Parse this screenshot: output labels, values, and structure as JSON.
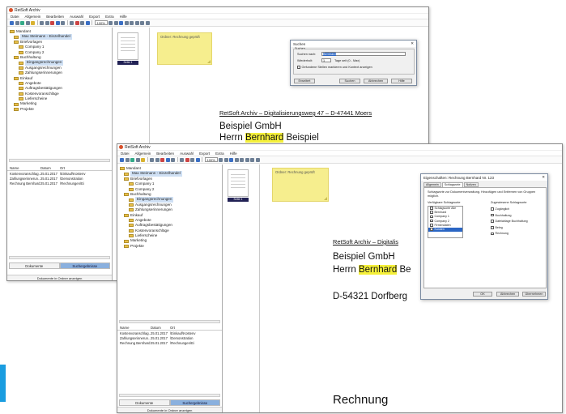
{
  "app": {
    "title": "RetSoft Archiv"
  },
  "menu": [
    "Datei",
    "Allgemein",
    "Bearbeiten",
    "Auswahl",
    "Export",
    "Extra",
    "Hilfe"
  ],
  "zoom": "100%",
  "tree": [
    {
      "label": "Mandant",
      "depth": 0
    },
    {
      "label": "Max Steimann - Einzelhandel",
      "depth": 1,
      "selected": true
    },
    {
      "label": "Briefvorlagen",
      "depth": 1
    },
    {
      "label": "Company 1",
      "depth": 2
    },
    {
      "label": "Company 2",
      "depth": 2
    },
    {
      "label": "Buchhaltung",
      "depth": 1
    },
    {
      "label": "Eingangsrechnungen",
      "depth": 2,
      "selected": true
    },
    {
      "label": "Ausgangsrechnungen",
      "depth": 2
    },
    {
      "label": "Zahlungserinnerungen",
      "depth": 2
    },
    {
      "label": "Einkauf",
      "depth": 1
    },
    {
      "label": "Angebote",
      "depth": 2
    },
    {
      "label": "Auftragsbestätigungen",
      "depth": 2
    },
    {
      "label": "Kostenvoranschläge",
      "depth": 2
    },
    {
      "label": "Lieferscheine",
      "depth": 2
    },
    {
      "label": "Marketing",
      "depth": 1
    },
    {
      "label": "Projekte",
      "depth": 1
    }
  ],
  "list": {
    "headers": [
      "Name",
      "Datum",
      "Ort"
    ],
    "rows": [
      [
        "Kostenvoranschlag…",
        "25.01.2017",
        "\\Einkauf\\Kostenv"
      ],
      [
        "Zahlungserinnerun…",
        "25.01.2017",
        "\\Demonstration"
      ],
      [
        "Rechnung Bernhard…",
        "25.01.2017",
        "\\Rechnungen\\Ei"
      ]
    ]
  },
  "tabs": {
    "left": "Dokumente",
    "right": "Suchergebnisse"
  },
  "status": "Dokumente in Ordner anzeigen",
  "thumb_label": "Seite 1",
  "note_text": "Ordner: Rechnung geprüft",
  "doc": {
    "sender": "RetSoft Archiv – Digitalisierungsweg 47 – D-47441 Moers",
    "sender_short": "RetSoft Archiv – Digitalis",
    "company": "Beispiel GmbH",
    "salutation": "Herrn",
    "first_name": "Bernhard",
    "last_name": "Beispiel",
    "last_name_short": "Be",
    "city": "D-54321 Dorfberg",
    "heading": "Rechnung"
  },
  "search_dialog": {
    "title": "Suchen",
    "group": "Suchen",
    "search_label": "Suchen nach:",
    "search_value": "Bernhard",
    "where_label": "Wiederholt:",
    "where_value": "1",
    "range": "Tage seit (0 - Max)",
    "option": "Gefundene Stellen markieren und Kontext anzeigen",
    "buttons": [
      "Erweitert",
      "Suchen",
      "Abbrechen",
      "Hilfe"
    ]
  },
  "props_dialog": {
    "title": "Eigenschaften: Rechnung Bernhard Nr. 123",
    "tabs": [
      "Allgemein",
      "Schlagworte",
      "Notizen"
    ],
    "desc": "Schlagworte zur Dokumentverwaltung. Hinzufügen und Entfernen von Gruppen möglich.",
    "avail_header": "Verfügbare Schlagworte",
    "assigned_header": "Zugewiesene Schlagworte",
    "available": [
      "Schlagworte Alle",
      "Bernhard",
      "Company 1",
      "Company 2",
      "Firmendaten",
      "Kunden"
    ],
    "assigned": [
      "Zugänglich",
      "Buchhaltung",
      "Dateiablage Buchhaltung",
      "Beleg",
      "Rechnung"
    ],
    "buttons": [
      "OK",
      "Abbrechen",
      "Übernehmen"
    ]
  }
}
